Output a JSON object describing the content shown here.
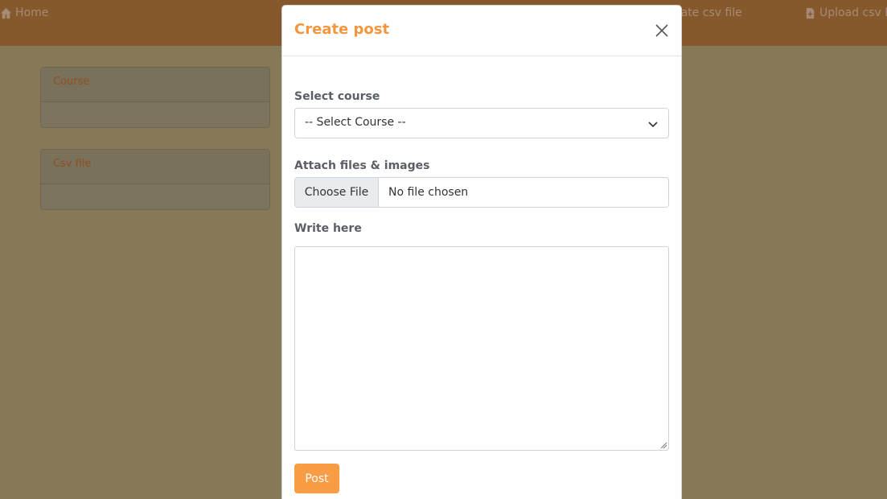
{
  "navbar": {
    "home_label": "Home",
    "create_label": "eate csv file",
    "upload_label": "Upload csv Fi"
  },
  "cards": {
    "course_title": "Course",
    "csv_title": "Csv file"
  },
  "modal": {
    "title": "Create post",
    "course_label": "Select course",
    "course_selected": "-- Select Course --",
    "attach_label": "Attach files & images",
    "file_button": "Choose File",
    "file_status": "No file chosen",
    "write_label": "Write here",
    "textarea_value": "",
    "post_button": "Post"
  },
  "colors": {
    "accent": "#f99d45",
    "title": "#f3963d",
    "navbar": "#86592c"
  },
  "icons": {
    "home": "home-icon",
    "file": "file-icon",
    "close": "close-icon",
    "chevron": "chevron-down-icon"
  }
}
